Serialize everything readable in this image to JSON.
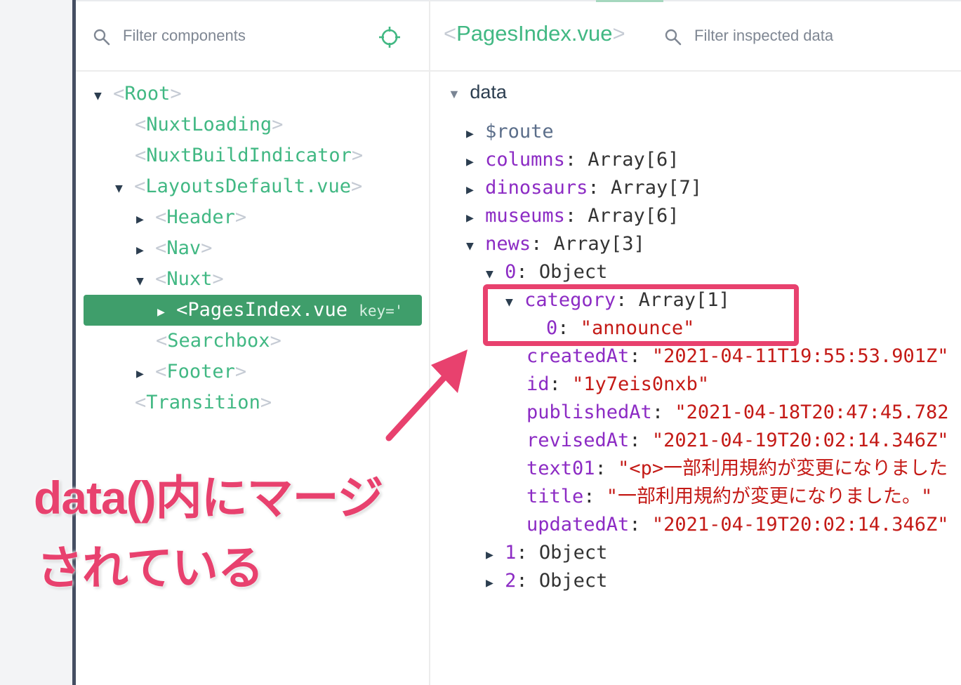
{
  "left_panel": {
    "filter_placeholder": "Filter components",
    "tree": [
      {
        "name": "Root",
        "expanded": true
      },
      {
        "name": "NuxtLoading"
      },
      {
        "name": "NuxtBuildIndicator"
      },
      {
        "name": "LayoutsDefault.vue",
        "expanded": true
      },
      {
        "name": "Header",
        "expanded": false
      },
      {
        "name": "Nav",
        "expanded": false
      },
      {
        "name": "Nuxt",
        "expanded": true
      },
      {
        "name": "PagesIndex.vue",
        "expanded": false,
        "selected": true,
        "key_text": "key='"
      },
      {
        "name": "Searchbox"
      },
      {
        "name": "Footer",
        "expanded": false
      },
      {
        "name": "Transition"
      }
    ]
  },
  "right_panel": {
    "component_name": "PagesIndex.vue",
    "filter_placeholder": "Filter inspected data",
    "section": "data",
    "rows": {
      "route": {
        "key": "$route"
      },
      "columns": {
        "key": "columns",
        "value": "Array[6]"
      },
      "dinosaurs": {
        "key": "dinosaurs",
        "value": "Array[7]"
      },
      "museums": {
        "key": "museums",
        "value": "Array[6]"
      },
      "news": {
        "key": "news",
        "value": "Array[3]"
      },
      "news0": {
        "key": "0",
        "value": "Object"
      },
      "category": {
        "key": "category",
        "value": "Array[1]"
      },
      "category0": {
        "key": "0",
        "value": "\"announce\""
      },
      "createdAt": {
        "key": "createdAt",
        "value": "\"2021-04-11T19:55:53.901Z\""
      },
      "id": {
        "key": "id",
        "value": "\"1y7eis0nxb\""
      },
      "publishedAt": {
        "key": "publishedAt",
        "value": "\"2021-04-18T20:47:45.782"
      },
      "revisedAt": {
        "key": "revisedAt",
        "value": "\"2021-04-19T20:02:14.346Z\""
      },
      "text01": {
        "key": "text01",
        "value": "\"<p>一部利用規約が変更になりました"
      },
      "title": {
        "key": "title",
        "value": "\"一部利用規約が変更になりました。\""
      },
      "updatedAt": {
        "key": "updatedAt",
        "value": "\"2021-04-19T20:02:14.346Z\""
      },
      "news1": {
        "key": "1",
        "value": "Object"
      },
      "news2": {
        "key": "2",
        "value": "Object"
      }
    }
  },
  "annotation": {
    "line1": "data()内にマージ",
    "line2": "されている",
    "color": "#e8416e"
  },
  "colors": {
    "tag_green": "#41b883",
    "selection_green": "#3f9e6b",
    "key_purple": "#8c2bc4",
    "string_red": "#c41a16",
    "highlight_pink": "#e8416e"
  }
}
